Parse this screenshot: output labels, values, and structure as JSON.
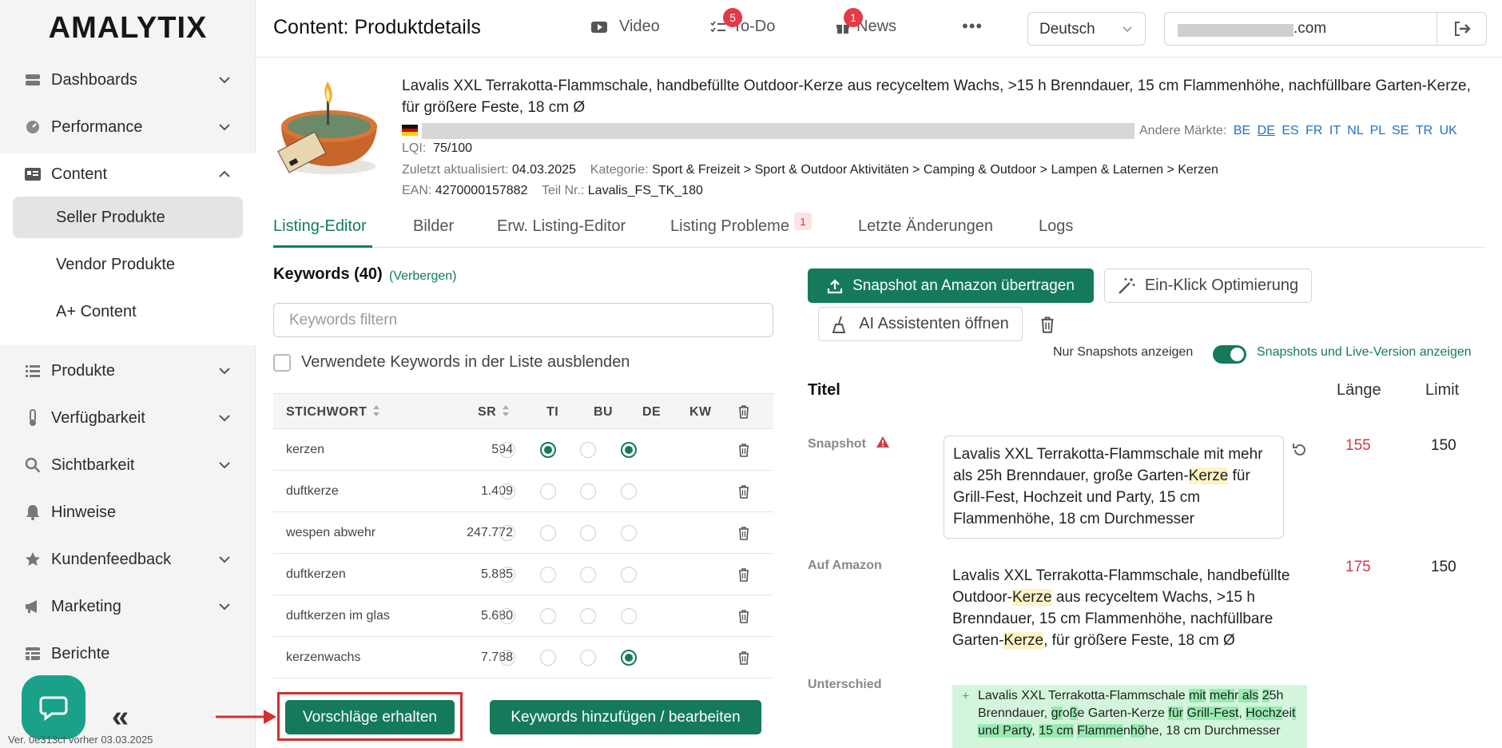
{
  "app": {
    "logo": "AMALYTIX",
    "version": "Ver. 0e313cf vorher 03.03.2025"
  },
  "sidebar": {
    "items": [
      {
        "label": "Dashboards",
        "icon": "dashboard-icon"
      },
      {
        "label": "Performance",
        "icon": "performance-icon"
      },
      {
        "label": "Content",
        "icon": "content-icon"
      },
      {
        "label": "Produkte",
        "icon": "list-icon"
      },
      {
        "label": "Verfügbarkeit",
        "icon": "thermometer-icon"
      },
      {
        "label": "Sichtbarkeit",
        "icon": "search-icon"
      },
      {
        "label": "Hinweise",
        "icon": "bell-icon"
      },
      {
        "label": "Kundenfeedback",
        "icon": "star-icon"
      },
      {
        "label": "Marketing",
        "icon": "megaphone-icon"
      },
      {
        "label": "Berichte",
        "icon": "table-icon"
      }
    ],
    "content_sub": [
      "Seller Produkte",
      "Vendor Produkte",
      "A+ Content"
    ]
  },
  "header": {
    "title": "Content: Produktdetails",
    "video": "Video",
    "todo": "To-Do",
    "todo_count": "5",
    "news": "News",
    "news_count": "1",
    "language": "Deutsch",
    "account_domain": ".com"
  },
  "product": {
    "title": "Lavalis XXL Terrakotta-Flammschale, handbefüllte Outdoor-Kerze aus recyceltem Wachs, >15 h Brenndauer, 15 cm Flammenhöhe, nachfüllbare Garten-Kerze, für größere Feste, 18 cm Ø",
    "other_markets_label": "Andere Märkte:",
    "markets": [
      "BE",
      "DE",
      "ES",
      "FR",
      "IT",
      "NL",
      "PL",
      "SE",
      "TR",
      "UK"
    ],
    "lqi_label": "LQI:",
    "lqi": "75/100",
    "updated_label": "Zuletzt aktualisiert:",
    "updated": "04.03.2025",
    "category_label": "Kategorie:",
    "category": "Sport & Freizeit > Sport & Outdoor Aktivitäten > Camping & Outdoor > Lampen & Laternen > Kerzen",
    "ean_label": "EAN:",
    "ean": "4270000157882",
    "part_label": "Teil Nr.:",
    "part": "Lavalis_FS_TK_180"
  },
  "tabs": [
    {
      "label": "Listing-Editor"
    },
    {
      "label": "Bilder"
    },
    {
      "label": "Erw. Listing-Editor"
    },
    {
      "label": "Listing Probleme",
      "badge": "1"
    },
    {
      "label": "Letzte Änderungen"
    },
    {
      "label": "Logs"
    }
  ],
  "keywords": {
    "title": "Keywords (40)",
    "hide_link": "(Verbergen)",
    "filter_placeholder": "Keywords filtern",
    "hide_used": "Verwendete Keywords in der Liste ausblenden",
    "columns": [
      "STICHWORT",
      "SR",
      "TI",
      "BU",
      "DE",
      "KW"
    ],
    "rows": [
      {
        "kw": "kerzen",
        "sr": "594",
        "ti": false,
        "bu": true,
        "de": false,
        "kwc": true
      },
      {
        "kw": "duftkerze",
        "sr": "1.409",
        "ti": false,
        "bu": false,
        "de": false,
        "kwc": false
      },
      {
        "kw": "wespen abwehr",
        "sr": "247.772",
        "ti": false,
        "bu": false,
        "de": false,
        "kwc": false
      },
      {
        "kw": "duftkerzen",
        "sr": "5.885",
        "ti": false,
        "bu": false,
        "de": false,
        "kwc": false
      },
      {
        "kw": "duftkerzen im glas",
        "sr": "5.680",
        "ti": false,
        "bu": false,
        "de": false,
        "kwc": false
      },
      {
        "kw": "kerzenwachs",
        "sr": "7.788",
        "ti": false,
        "bu": false,
        "de": false,
        "kwc": true
      }
    ],
    "suggest_btn": "Vorschläge erhalten",
    "add_btn": "Keywords hinzufügen / bearbeiten"
  },
  "editor": {
    "upload_btn": "Snapshot an Amazon übertragen",
    "optimize_btn": "Ein-Klick Optimierung",
    "ai_btn": "AI Assistenten öffnen",
    "only_snapshots": "Nur Snapshots anzeigen",
    "snapshots_live": "Snapshots und Live-Version anzeigen",
    "section": "Titel",
    "col_length": "Länge",
    "col_limit": "Limit",
    "snapshot_label": "Snapshot",
    "snapshot_parts": [
      "Lavalis XXL Terrakotta-Flammschale mit mehr als 25h Brenndauer, große Garten-",
      "Kerze",
      " für Grill-Fest, Hochzeit und Party, 15 cm Flammenhöhe, 18 cm Durchmesser"
    ],
    "snapshot_length": "155",
    "snapshot_limit": "150",
    "amazon_label": "Auf Amazon",
    "amazon_parts": [
      "Lavalis XXL Terrakotta-Flammschale, handbefüllte Outdoor-",
      "Kerze",
      " aus recyceltem Wachs, >15 h Brenndauer, 15 cm Flammenhöhe, nachfüllbare Garten-",
      "Kerze",
      ", für größere Feste, 18 cm Ø"
    ],
    "amazon_length": "175",
    "amazon_limit": "150",
    "diff_label": "Unterschied",
    "diff_parts": [
      {
        "t": "Lavalis XXL Terrakotta-Flammschale ",
        "h": false
      },
      {
        "t": "mit",
        "h": true
      },
      {
        "t": " ",
        "h": false
      },
      {
        "t": "meh",
        "h": true
      },
      {
        "t": "r",
        "h": false
      },
      {
        "t": " als",
        "h": true
      },
      {
        "t": " ",
        "h": false
      },
      {
        "t": "2",
        "h": true
      },
      {
        "t": "5h Brenndauer, ",
        "h": false
      },
      {
        "t": "gr",
        "h": true
      },
      {
        "t": "o",
        "h": false
      },
      {
        "t": "ß",
        "h": true
      },
      {
        "t": "e Garten-Kerze ",
        "h": false
      },
      {
        "t": "für",
        "h": true
      },
      {
        "t": " ",
        "h": false
      },
      {
        "t": "Grill-Fest",
        "h": true
      },
      {
        "t": ", ",
        "h": false
      },
      {
        "t": "Hochz",
        "h": true
      },
      {
        "t": "ei",
        "h": false
      },
      {
        "t": "t",
        "h": true
      },
      {
        "t": " ",
        "h": false
      },
      {
        "t": "und Party",
        "h": true
      },
      {
        "t": ", ",
        "h": false
      },
      {
        "t": "15 cm",
        "h": true
      },
      {
        "t": " ",
        "h": false
      },
      {
        "t": "Flamme",
        "h": true
      },
      {
        "t": "n",
        "h": false
      },
      {
        "t": "hö",
        "h": true
      },
      {
        "t": "he",
        "h": false
      },
      {
        "t": ", 18 cm Durchmesser",
        "h": false
      }
    ]
  },
  "colors": {
    "accent": "#157a5c",
    "alert": "#d13a46",
    "highlight": "#fdf3c4",
    "diff": "#98eab1"
  }
}
